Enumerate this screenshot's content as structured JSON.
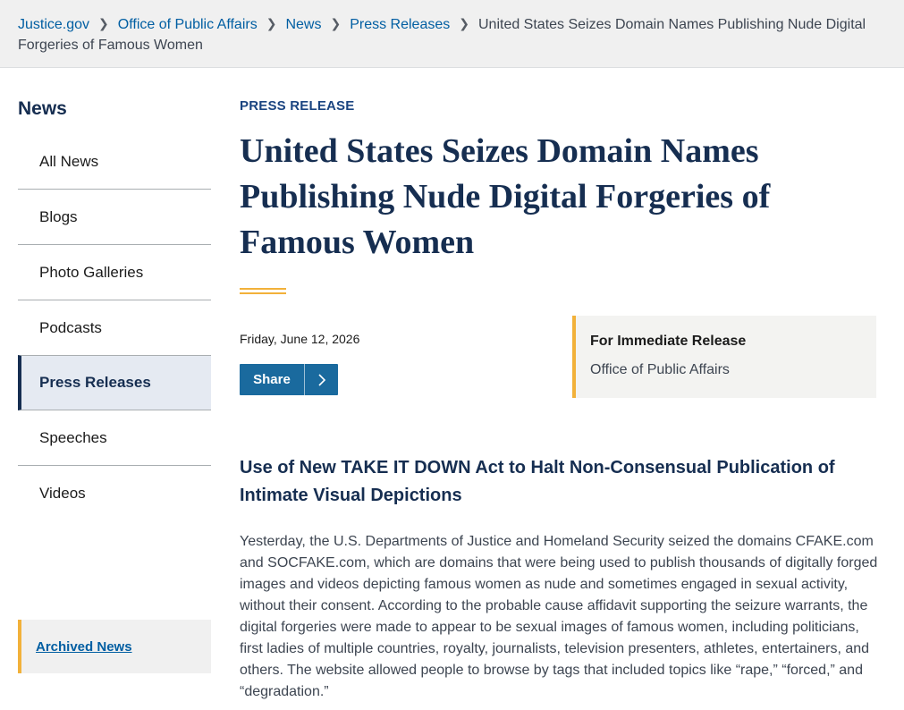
{
  "breadcrumb": {
    "items": [
      "Justice.gov",
      "Office of Public Affairs",
      "News",
      "Press Releases"
    ],
    "current": "United States Seizes Domain Names Publishing Nude Digital Forgeries of Famous Women"
  },
  "sidebar": {
    "title": "News",
    "items": [
      {
        "label": "All News"
      },
      {
        "label": "Blogs"
      },
      {
        "label": "Photo Galleries"
      },
      {
        "label": "Podcasts"
      },
      {
        "label": "Press Releases"
      },
      {
        "label": "Speeches"
      },
      {
        "label": "Videos"
      }
    ],
    "active": "Press Releases",
    "archived_label": "Archived News"
  },
  "article": {
    "kicker": "PRESS RELEASE",
    "headline": "United States Seizes Domain Names Publishing Nude Digital Forgeries of Famous Women",
    "date": "Friday, June 12, 2026",
    "share_label": "Share",
    "release_label": "For Immediate Release",
    "release_office": "Office of Public Affairs",
    "subhead": "Use of New TAKE IT DOWN Act to Halt Non-Consensual Publication of Intimate Visual Depictions",
    "body": "Yesterday, the U.S. Departments of Justice and Homeland Security seized the domains CFAKE.com and SOCFAKE.com, which are domains that were being used to publish thousands of digitally forged images and videos depicting famous women as nude and sometimes engaged in sexual activity, without their consent. According to the probable cause affidavit supporting the seizure warrants, the digital forgeries were made to appear to be sexual images of famous women, including politicians, first ladies of multiple countries, royalty, journalists, television presenters, athletes, entertainers, and others. The website allowed people to browse by tags that included topics like “rape,” “forced,” and “degradation.”"
  },
  "icons": {
    "breadcrumb_separator": "chevron-right-icon",
    "share_chevron": "chevron-right-icon"
  },
  "colors": {
    "navy": "#162e51",
    "link": "#005ea2",
    "accent_gold": "#f2b13a",
    "share_button": "#1a6a9e"
  }
}
